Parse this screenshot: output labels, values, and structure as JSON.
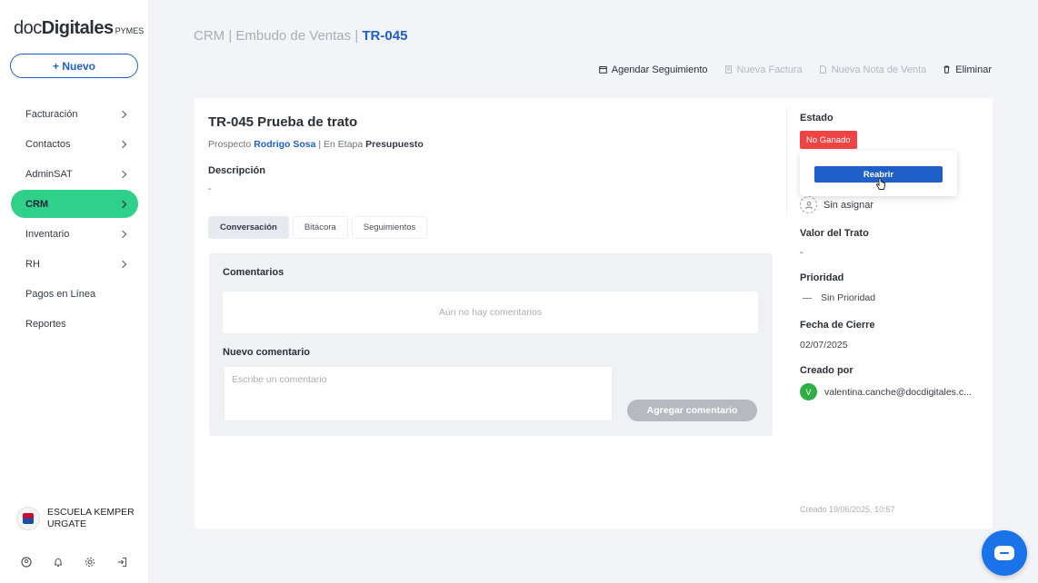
{
  "sidebar": {
    "logo": {
      "part1": "doc",
      "part2": "Digitales",
      "part3": "PYMES"
    },
    "new_button": "+ Nuevo",
    "items": [
      {
        "label": "Facturación",
        "chevron": true
      },
      {
        "label": "Contactos",
        "chevron": true
      },
      {
        "label": "AdminSAT",
        "chevron": true
      },
      {
        "label": "CRM",
        "chevron": true,
        "active": true
      },
      {
        "label": "Inventario",
        "chevron": true
      },
      {
        "label": "RH",
        "chevron": true
      },
      {
        "label": "Pagos en Línea",
        "chevron": false
      },
      {
        "label": "Reportes",
        "chevron": false
      }
    ],
    "org_name": "ESCUELA KEMPER URGATE",
    "footer_icons": [
      "user-circle-icon",
      "bell-icon",
      "gear-icon",
      "logout-icon"
    ]
  },
  "header": {
    "breadcrumb": {
      "path": "CRM | Embudo de Ventas | ",
      "current": "TR-045"
    },
    "actions": [
      {
        "label": "Agendar Seguimiento",
        "icon": "calendar-icon",
        "enabled": true
      },
      {
        "label": "Nueva Factura",
        "icon": "invoice-icon",
        "enabled": false
      },
      {
        "label": "Nueva Nota de Venta",
        "icon": "document-icon",
        "enabled": false
      },
      {
        "label": "Eliminar",
        "icon": "trash-icon",
        "enabled": true
      }
    ]
  },
  "deal": {
    "title": "TR-045  Prueba de trato",
    "prospect_prefix": "Prospecto ",
    "prospect_name": "Rodrigo Sosa",
    "stage_prefix": " | En Etapa ",
    "stage": "Presupuesto",
    "description_label": "Descripción",
    "description_value": "-"
  },
  "tabs": [
    {
      "label": "Conversación",
      "active": true
    },
    {
      "label": "Bitácora",
      "active": false
    },
    {
      "label": "Seguimientos",
      "active": false
    }
  ],
  "comments": {
    "header": "Comentarios",
    "empty": "Aún no hay comentarios",
    "new_label": "Nuevo comentario",
    "placeholder": "Escribe un comentario",
    "add_button": "Agregar comentario"
  },
  "details": {
    "status_label": "Estado",
    "status_value": "No Ganado",
    "status_color": "#ee4444",
    "reopen_button": "Reabrir",
    "assignee": "Sin asignar",
    "value_label": "Valor del Trato",
    "value": "-",
    "priority_label": "Prioridad",
    "priority": "Sin Prioridad",
    "close_date_label": "Fecha de Cierre",
    "close_date": "02/07/2025",
    "created_by_label": "Creado por",
    "creator_initial": "V",
    "creator_email": "valentina.canche@docdigitales.c...",
    "created_at": "Creado 19/06/2025, 10:57"
  },
  "colors": {
    "accent": "#1e5fc8",
    "active_nav": "#2ed08a",
    "chat_fab": "#1a73e8"
  }
}
